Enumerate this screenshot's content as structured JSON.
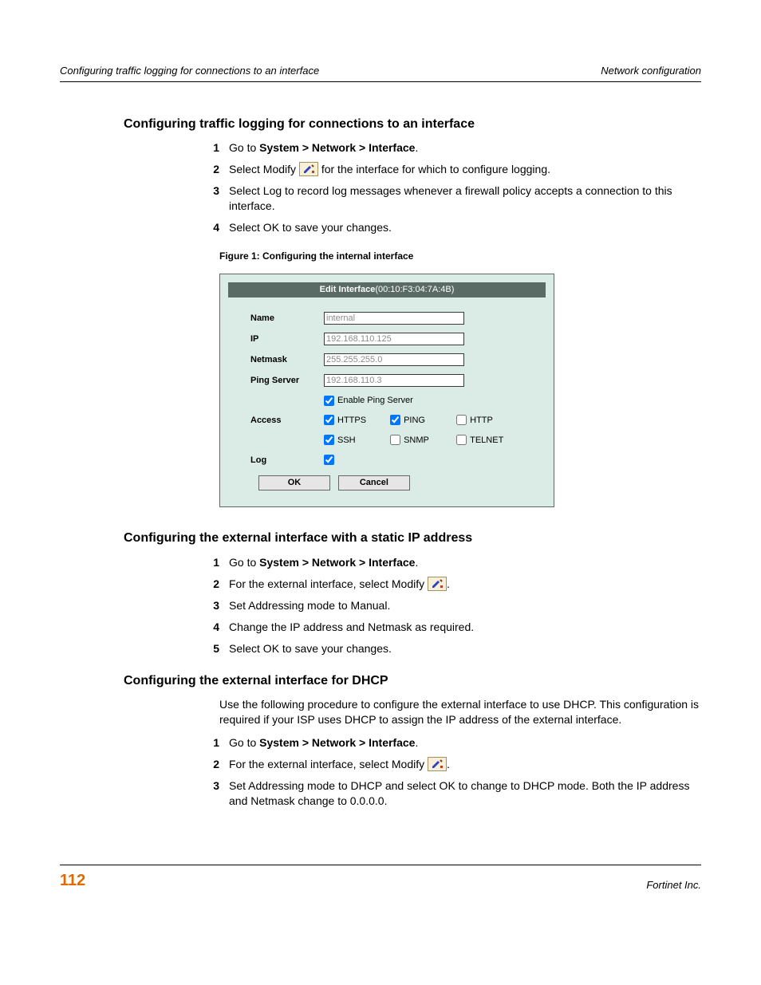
{
  "header": {
    "left": "Configuring traffic logging for connections to an interface",
    "right": "Network configuration"
  },
  "sections": {
    "s1": {
      "title": "Configuring traffic logging for connections to an interface",
      "steps": {
        "n1": "1",
        "t1a": "Go to ",
        "t1b": "System > Network > Interface",
        "t1c": ".",
        "n2": "2",
        "t2a": "Select Modify ",
        "t2b": " for the interface for which to configure logging.",
        "n3": "3",
        "t3": "Select Log to record log messages whenever a firewall policy accepts a connection to this interface.",
        "n4": "4",
        "t4": "Select OK to save your changes."
      }
    },
    "figure": {
      "caption": "Figure 1:   Configuring the internal interface",
      "title_label": "Edit Interface",
      "title_mac": "(00:10:F3:04:7A:4B)",
      "labels": {
        "name": "Name",
        "ip": "IP",
        "netmask": "Netmask",
        "ping": "Ping Server",
        "access": "Access",
        "log": "Log"
      },
      "values": {
        "name": "internal",
        "ip": "192.168.110.125",
        "netmask": "255.255.255.0",
        "ping": "192.168.110.3"
      },
      "checks": {
        "enable_ps": "Enable Ping Server",
        "a1": "HTTPS",
        "a2": "PING",
        "a3": "HTTP",
        "b1": "SSH",
        "b2": "SNMP",
        "b3": "TELNET"
      },
      "buttons": {
        "ok": "OK",
        "cancel": "Cancel"
      }
    },
    "s2": {
      "title": "Configuring the external interface with a static IP address",
      "steps": {
        "n1": "1",
        "t1a": "Go to ",
        "t1b": "System > Network > Interface",
        "t1c": ".",
        "n2": "2",
        "t2a": "For the external interface, select Modify ",
        "t2b": ".",
        "n3": "3",
        "t3": "Set Addressing mode to Manual.",
        "n4": "4",
        "t4": "Change the IP address and Netmask as required.",
        "n5": "5",
        "t5": "Select OK to save your changes."
      }
    },
    "s3": {
      "title": "Configuring the external interface for DHCP",
      "intro": "Use the following procedure to configure the external interface to use DHCP. This configuration is required if your ISP uses DHCP to assign the IP address of the external interface.",
      "steps": {
        "n1": "1",
        "t1a": "Go to ",
        "t1b": "System > Network > Interface",
        "t1c": ".",
        "n2": "2",
        "t2a": "For the external interface, select Modify ",
        "t2b": ".",
        "n3": "3",
        "t3": "Set Addressing mode to DHCP and select OK to change to DHCP mode. Both the IP address and Netmask change to 0.0.0.0."
      }
    }
  },
  "footer": {
    "page": "112",
    "right": "Fortinet Inc."
  }
}
